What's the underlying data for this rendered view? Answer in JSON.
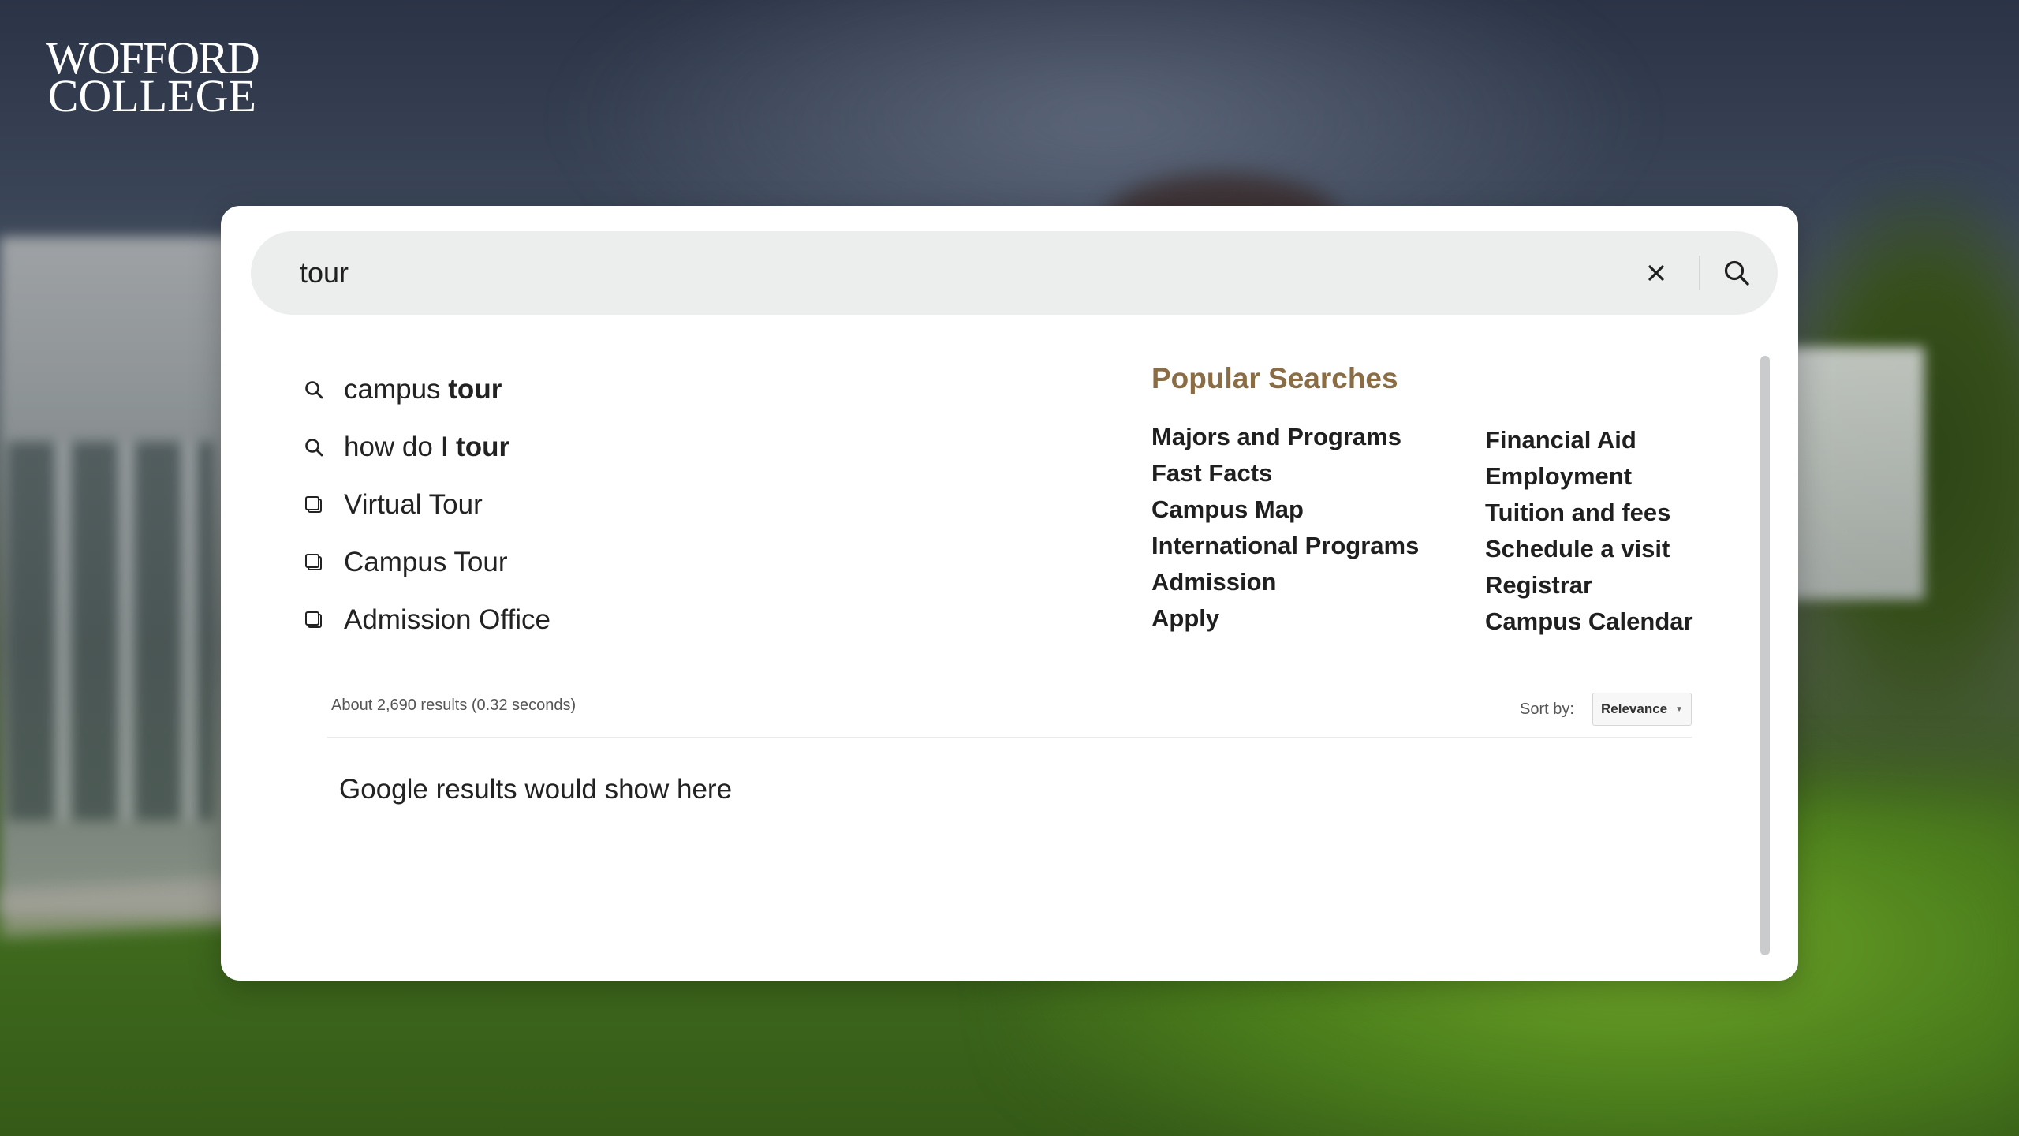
{
  "logo": {
    "line1": "WOFFORD",
    "line2": "COLLEGE"
  },
  "search": {
    "query": "tour",
    "clear_icon": "close-icon",
    "submit_icon": "search-icon"
  },
  "suggestions": [
    {
      "type": "query",
      "icon": "search-icon",
      "prefix": "campus ",
      "bold": "tour"
    },
    {
      "type": "query",
      "icon": "search-icon",
      "prefix": "how do I ",
      "bold": "tour"
    },
    {
      "type": "page",
      "icon": "page-icon",
      "prefix": "Virtual Tour",
      "bold": ""
    },
    {
      "type": "page",
      "icon": "page-icon",
      "prefix": "Campus Tour",
      "bold": ""
    },
    {
      "type": "page",
      "icon": "page-icon",
      "prefix": "Admission Office",
      "bold": ""
    }
  ],
  "popular": {
    "title": "Popular Searches",
    "title_color": "#8a6d45",
    "column_a": [
      "Majors and Programs",
      "Fast Facts",
      "Campus Map",
      "International Programs",
      "Admission",
      "Apply"
    ],
    "column_b": [
      "Financial Aid",
      "Employment",
      "Tuition and fees",
      "Schedule a visit",
      "Registrar",
      "Campus Calendar"
    ]
  },
  "results": {
    "summary": "About 2,690 results (0.32 seconds)",
    "sort_label": "Sort by:",
    "sort_value": "Relevance",
    "placeholder": "Google results would show here"
  }
}
